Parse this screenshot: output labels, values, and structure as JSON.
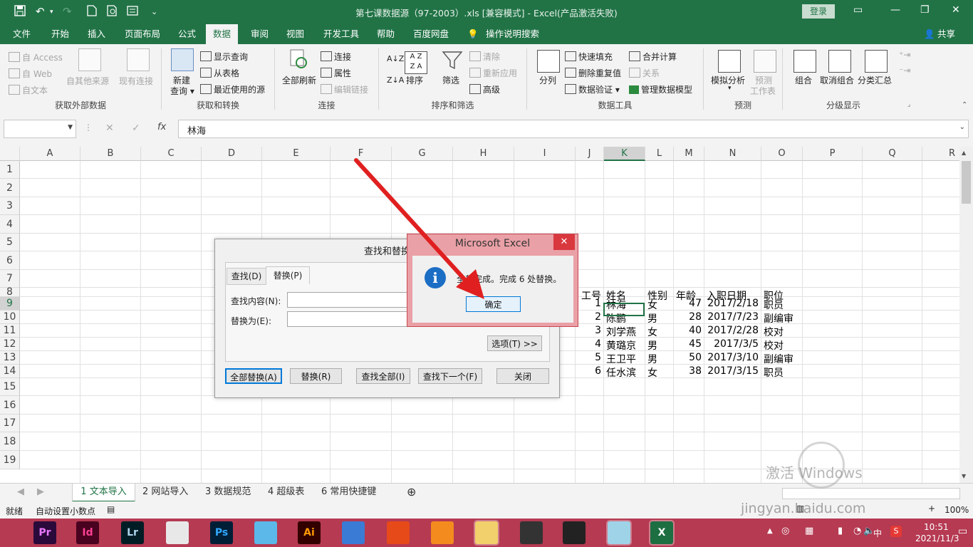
{
  "window": {
    "title": "第七课数据源（97-2003）.xls  [兼容模式]  -  Excel(产品激活失败)",
    "login": "登录"
  },
  "tabs": [
    "文件",
    "开始",
    "插入",
    "页面布局",
    "公式",
    "数据",
    "审阅",
    "视图",
    "开发工具",
    "帮助",
    "百度网盘",
    "操作说明搜索"
  ],
  "share": "共享",
  "ribbon": {
    "external": {
      "access": "自 Access",
      "web": "自 Web",
      "text": "自文本",
      "other": "自其他来源",
      "existing": "现有连接",
      "group": "获取外部数据"
    },
    "transform": {
      "new_query_1": "新建",
      "new_query_2": "查询",
      "show_query": "显示查询",
      "from_table": "从表格",
      "recent": "最近使用的源",
      "group": "获取和转换"
    },
    "connections": {
      "refresh_all": "全部刷新",
      "connections": "连接",
      "properties": "属性",
      "edit_links": "编辑链接",
      "group": "连接"
    },
    "sortfilter": {
      "sort": "排序",
      "filter": "筛选",
      "clear": "清除",
      "reapply": "重新应用",
      "advanced": "高级",
      "group": "排序和筛选"
    },
    "datatools": {
      "split": "分列",
      "flash_fill": "快速填充",
      "remove_dup": "删除重复值",
      "validation": "数据验证",
      "consolidate": "合并计算",
      "relations": "关系",
      "data_model": "管理数据模型",
      "group": "数据工具"
    },
    "forecast": {
      "whatif": "模拟分析",
      "forecast_1": "预测",
      "forecast_2": "工作表",
      "group": "预测"
    },
    "outline": {
      "group_btn": "组合",
      "ungroup": "取消组合",
      "subtotal": "分类汇总",
      "group": "分级显示"
    }
  },
  "formula_bar": {
    "value": "林海"
  },
  "columns": [
    "A",
    "B",
    "C",
    "D",
    "E",
    "F",
    "G",
    "H",
    "I",
    "J",
    "K",
    "L",
    "M",
    "N",
    "O",
    "P",
    "Q",
    "R"
  ],
  "rows": [
    "1",
    "2",
    "3",
    "4",
    "5",
    "6",
    "7",
    "8",
    "9",
    "10",
    "11",
    "12",
    "13",
    "14",
    "15",
    "16",
    "17",
    "18",
    "19"
  ],
  "table": {
    "header": [
      "工号",
      "姓名",
      "性别",
      "年龄",
      "入职日期",
      "职位"
    ],
    "rows": [
      [
        "1",
        "林海",
        "女",
        "47",
        "2017/2/18",
        "职员"
      ],
      [
        "2",
        "陈鹏",
        "男",
        "28",
        "2017/7/23",
        "副编审"
      ],
      [
        "3",
        "刘学燕",
        "女",
        "40",
        "2017/2/28",
        "校对"
      ],
      [
        "4",
        "黄璐京",
        "男",
        "45",
        "2017/3/5",
        "校对"
      ],
      [
        "5",
        "王卫平",
        "男",
        "50",
        "2017/3/10",
        "副编审"
      ],
      [
        "6",
        "任水滨",
        "女",
        "38",
        "2017/3/15",
        "职员"
      ]
    ]
  },
  "find_dialog": {
    "title": "查找和替换",
    "tab_find": "查找(D)",
    "tab_replace": "替换(P)",
    "find_label": "查找内容(N):",
    "replace_label": "替换为(E):",
    "options": "选项(T) >>",
    "replace_all": "全部替换(A)",
    "replace": "替换(R)",
    "find_all": "查找全部(I)",
    "find_next": "查找下一个(F)",
    "close": "关闭"
  },
  "message_box": {
    "title": "Microsoft Excel",
    "message": "全部完成。完成 6 处替换。",
    "ok": "确定"
  },
  "sheets": [
    "1 文本导入",
    "2 网站导入",
    "3 数据规范",
    "4 超级表",
    "6 常用快捷键"
  ],
  "status": {
    "ready": "就绪",
    "auto_decimal": "自动设置小数点",
    "zoom": "100%"
  },
  "clock": {
    "time": "10:51",
    "date": "2021/11/3"
  },
  "watermark": {
    "activate": "激活 Windows",
    "site": "jingyan.baidu.com"
  },
  "taskbar_apps": [
    {
      "label": "Pr",
      "color": "#2a0a3a",
      "fg": "#ea77ff"
    },
    {
      "label": "Id",
      "color": "#49021f",
      "fg": "#ff3f94"
    },
    {
      "label": "Lr",
      "color": "#001d26",
      "fg": "#add5ec"
    },
    {
      "label": "",
      "color": "#e8e8e8",
      "fg": "#333"
    },
    {
      "label": "Ps",
      "color": "#001e36",
      "fg": "#31a8ff"
    },
    {
      "label": "",
      "color": "#5bb8e8",
      "fg": "#fff"
    },
    {
      "label": "Ai",
      "color": "#330000",
      "fg": "#ff9a00"
    },
    {
      "label": "",
      "color": "#3a7bd5",
      "fg": "#fff"
    },
    {
      "label": "",
      "color": "#e64a19",
      "fg": "#fff"
    },
    {
      "label": "",
      "color": "#f48b1f",
      "fg": "#fff"
    },
    {
      "label": "",
      "color": "#f2d06b",
      "fg": "#333"
    },
    {
      "label": "",
      "color": "#333",
      "fg": "#fff"
    },
    {
      "label": "",
      "color": "#222",
      "fg": "#fff"
    },
    {
      "label": "",
      "color": "#9fd3e8",
      "fg": "#333"
    },
    {
      "label": "X",
      "color": "#1d6f42",
      "fg": "#fff"
    }
  ]
}
